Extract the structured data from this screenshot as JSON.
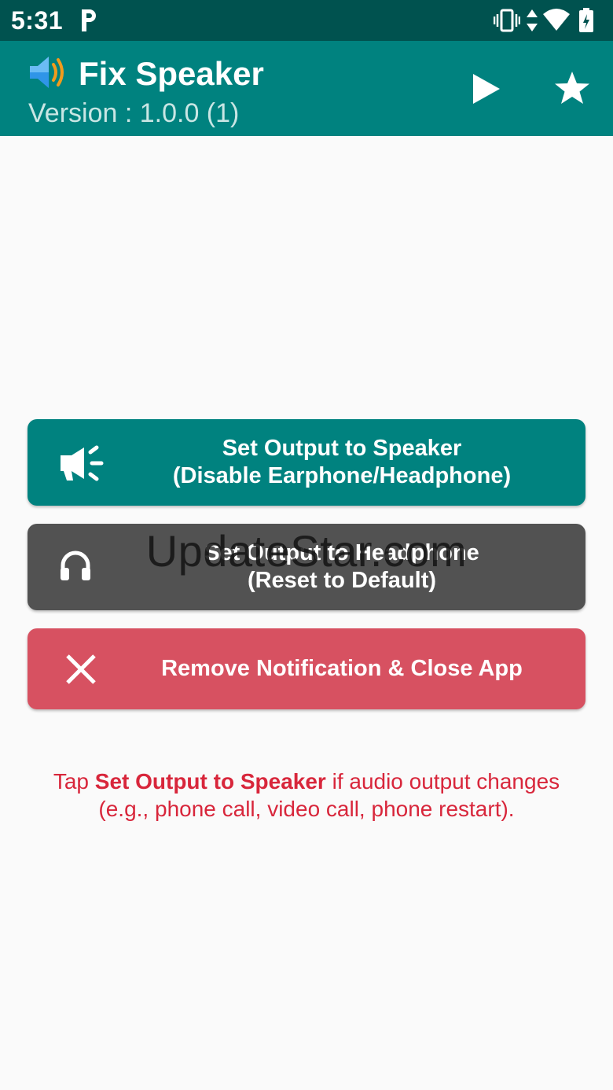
{
  "status_bar": {
    "time": "5:31",
    "notification_icon": "parking-p-icon",
    "icons": [
      "vibrate-icon",
      "data-arrows-icon",
      "wifi-icon",
      "battery-charging-icon"
    ]
  },
  "app_bar": {
    "icon": "speaker-volume-icon",
    "title": "Fix Speaker",
    "subtitle": "Version : 1.0.0 (1)",
    "actions": [
      "play-icon",
      "star-icon"
    ]
  },
  "buttons": {
    "speaker": {
      "icon": "megaphone-icon",
      "line1": "Set Output to Speaker",
      "line2": "(Disable Earphone/Headphone)",
      "color": "#00827f"
    },
    "headphone": {
      "icon": "headphones-icon",
      "line1": "Set Output to Headphone",
      "line2": "(Reset to Default)",
      "color": "#525252"
    },
    "close": {
      "icon": "close-x-icon",
      "label": "Remove Notification & Close App",
      "color": "#d75161"
    }
  },
  "watermark": "UpdateStar.com",
  "hint": {
    "prefix": "Tap ",
    "bold": "Set Output to Speaker",
    "middle": " if audio output changes",
    "line2": "(e.g., phone call, video call, phone restart).",
    "color": "#d8263b"
  },
  "colors": {
    "status_bar": "#00524f",
    "app_bar": "#00827f",
    "background": "#fafafa"
  }
}
